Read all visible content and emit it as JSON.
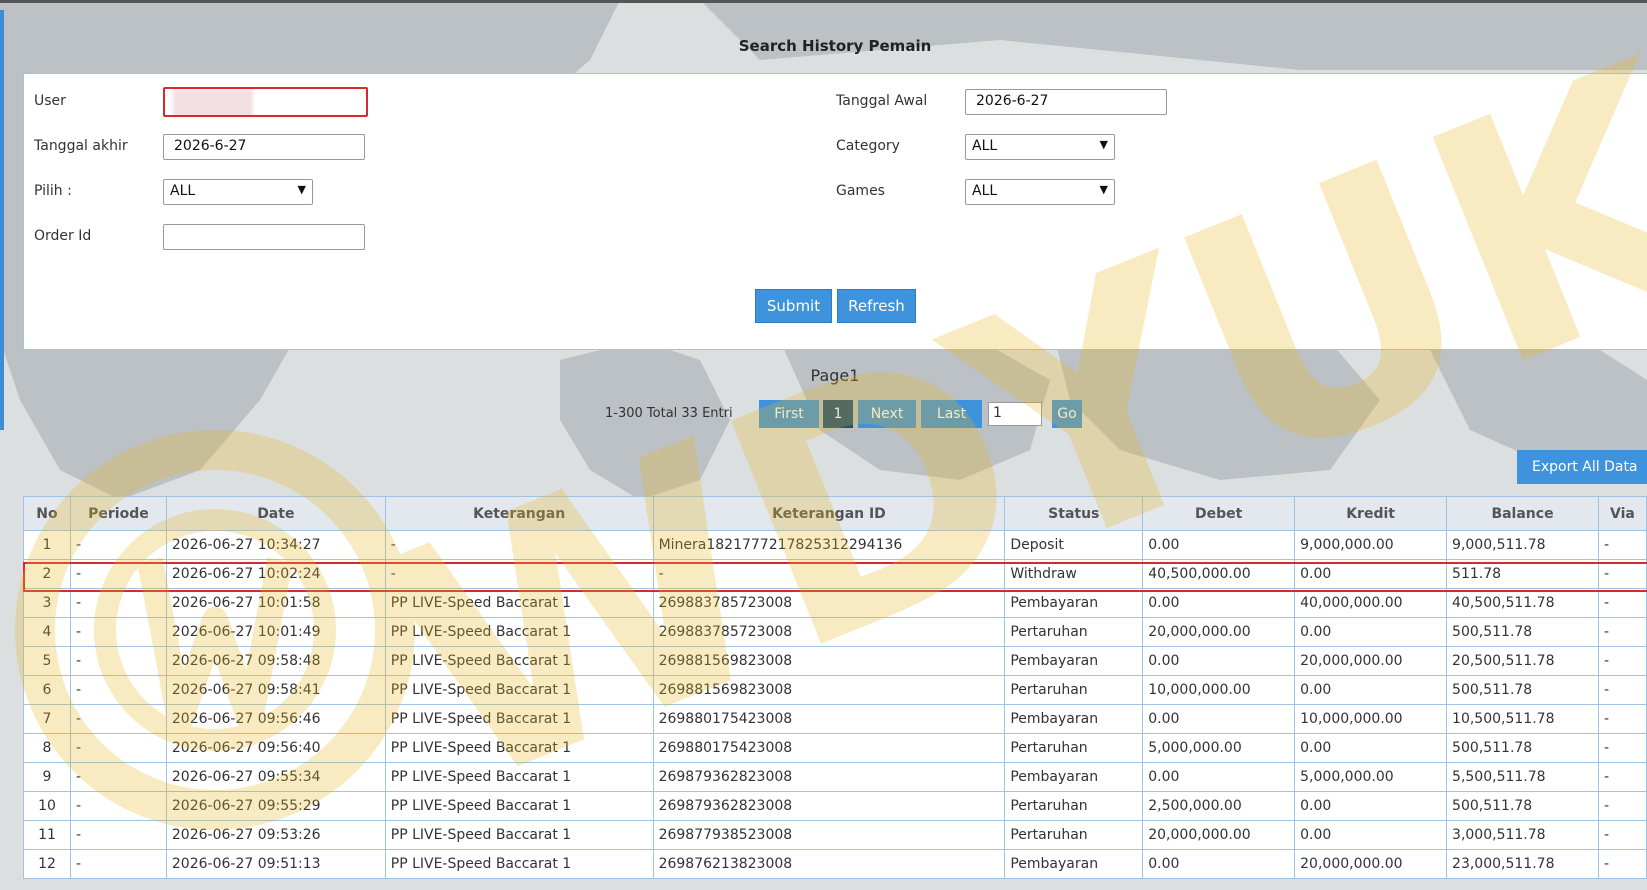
{
  "page": {
    "title": "Search History Pemain"
  },
  "form": {
    "user": {
      "label": "User",
      "value": ""
    },
    "tanggal_awal": {
      "label": "Tanggal Awal",
      "value": "2026-6-27"
    },
    "tanggal_akhir": {
      "label": "Tanggal akhir",
      "value": "2026-6-27"
    },
    "category": {
      "label": "Category",
      "value": "ALL"
    },
    "pilih": {
      "label": "Pilih  :",
      "value": "ALL"
    },
    "games": {
      "label": "Games",
      "value": "ALL"
    },
    "order_id": {
      "label": "Order Id",
      "value": ""
    },
    "submit_label": "Submit",
    "refresh_label": "Refresh"
  },
  "pager": {
    "page_label": "Page1",
    "total": "1-300 Total 33 Entri",
    "first": "First",
    "current": "1",
    "next": "Next",
    "last": "Last",
    "input_value": "1",
    "go": "Go"
  },
  "export_label": "Export All Data",
  "table": {
    "headers": [
      "No",
      "Periode",
      "Date",
      "Keterangan",
      "Keterangan ID",
      "Status",
      "Debet",
      "Kredit",
      "Balance",
      "Via"
    ],
    "rows": [
      [
        "1",
        "-",
        "2026-06-27 10:34:27",
        "-",
        "Minera1821777217825312294136",
        "Deposit",
        "0.00",
        "9,000,000.00",
        "9,000,511.78",
        "-"
      ],
      [
        "2",
        "-",
        "2026-06-27 10:02:24",
        "-",
        "-",
        "Withdraw",
        "40,500,000.00",
        "0.00",
        "511.78",
        "-"
      ],
      [
        "3",
        "-",
        "2026-06-27 10:01:58",
        "PP LIVE-Speed Baccarat 1",
        "269883785723008",
        "Pembayaran",
        "0.00",
        "40,000,000.00",
        "40,500,511.78",
        "-"
      ],
      [
        "4",
        "-",
        "2026-06-27 10:01:49",
        "PP LIVE-Speed Baccarat 1",
        "269883785723008",
        "Pertaruhan",
        "20,000,000.00",
        "0.00",
        "500,511.78",
        "-"
      ],
      [
        "5",
        "-",
        "2026-06-27 09:58:48",
        "PP LIVE-Speed Baccarat 1",
        "269881569823008",
        "Pembayaran",
        "0.00",
        "20,000,000.00",
        "20,500,511.78",
        "-"
      ],
      [
        "6",
        "-",
        "2026-06-27 09:58:41",
        "PP LIVE-Speed Baccarat 1",
        "269881569823008",
        "Pertaruhan",
        "10,000,000.00",
        "0.00",
        "500,511.78",
        "-"
      ],
      [
        "7",
        "-",
        "2026-06-27 09:56:46",
        "PP LIVE-Speed Baccarat 1",
        "269880175423008",
        "Pembayaran",
        "0.00",
        "10,000,000.00",
        "10,500,511.78",
        "-"
      ],
      [
        "8",
        "-",
        "2026-06-27 09:56:40",
        "PP LIVE-Speed Baccarat 1",
        "269880175423008",
        "Pertaruhan",
        "5,000,000.00",
        "0.00",
        "500,511.78",
        "-"
      ],
      [
        "9",
        "-",
        "2026-06-27 09:55:34",
        "PP LIVE-Speed Baccarat 1",
        "269879362823008",
        "Pembayaran",
        "0.00",
        "5,000,000.00",
        "5,500,511.78",
        "-"
      ],
      [
        "10",
        "-",
        "2026-06-27 09:55:29",
        "PP LIVE-Speed Baccarat 1",
        "269879362823008",
        "Pertaruhan",
        "2,500,000.00",
        "0.00",
        "500,511.78",
        "-"
      ],
      [
        "11",
        "-",
        "2026-06-27 09:53:26",
        "PP LIVE-Speed Baccarat 1",
        "269877938523008",
        "Pertaruhan",
        "20,000,000.00",
        "0.00",
        "3,000,511.78",
        "-"
      ],
      [
        "12",
        "-",
        "2026-06-27 09:51:13",
        "PP LIVE-Speed Baccarat 1",
        "269876213823008",
        "Pembayaran",
        "0.00",
        "20,000,000.00",
        "23,000,511.78",
        "-"
      ]
    ]
  },
  "watermark": {
    "text": "WDYUK"
  },
  "colors": {
    "accent": "#3e93dc",
    "active_page": "#1d4f7b",
    "debit_red": "#d21c1c",
    "credit_green": "#138a2c",
    "highlight": "#d9282e"
  }
}
